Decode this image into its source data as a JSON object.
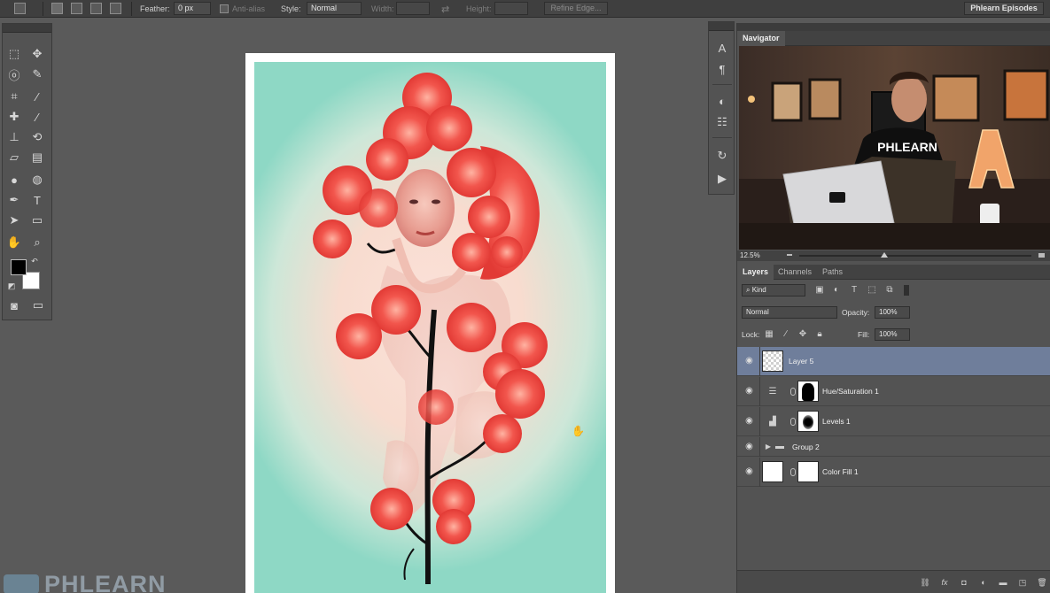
{
  "options_bar": {
    "feather_label": "Feather:",
    "feather_value": "0 px",
    "anti_alias_label": "Anti-alias",
    "style_label": "Style:",
    "style_value": "Normal",
    "width_label": "Width:",
    "height_label": "Height:",
    "refine_edge_label": "Refine Edge...",
    "workspace_label": "Phlearn Episodes"
  },
  "tools": [
    {
      "name": "marquee-tool-icon",
      "glyph": "⬚"
    },
    {
      "name": "move-tool-icon",
      "glyph": "✥"
    },
    {
      "name": "lasso-tool-icon",
      "glyph": "ⓞ"
    },
    {
      "name": "quick-selection-tool-icon",
      "glyph": "✎"
    },
    {
      "name": "crop-tool-icon",
      "glyph": "⌗"
    },
    {
      "name": "eyedropper-tool-icon",
      "glyph": "⁄"
    },
    {
      "name": "healing-brush-tool-icon",
      "glyph": "✚"
    },
    {
      "name": "brush-tool-icon",
      "glyph": "∕"
    },
    {
      "name": "clone-stamp-tool-icon",
      "glyph": "⊥"
    },
    {
      "name": "history-brush-tool-icon",
      "glyph": "⟲"
    },
    {
      "name": "eraser-tool-icon",
      "glyph": "▱"
    },
    {
      "name": "gradient-tool-icon",
      "glyph": "▤"
    },
    {
      "name": "blur-tool-icon",
      "glyph": "●"
    },
    {
      "name": "dodge-tool-icon",
      "glyph": "◍"
    },
    {
      "name": "pen-tool-icon",
      "glyph": "✒"
    },
    {
      "name": "type-tool-icon",
      "glyph": "T"
    },
    {
      "name": "path-selection-tool-icon",
      "glyph": "➤"
    },
    {
      "name": "shape-tool-icon",
      "glyph": "▭"
    },
    {
      "name": "hand-tool-icon",
      "glyph": "✋"
    },
    {
      "name": "zoom-tool-icon",
      "glyph": "⌕"
    }
  ],
  "strip_icons": [
    "character-icon",
    "paragraph-icon",
    "adjustments-icon",
    "properties-icon",
    "history-icon",
    "actions-icon"
  ],
  "navigator": {
    "tab_label": "Navigator",
    "zoom_value": "12.5%",
    "tshirt_text": "PHLEARN",
    "sign_letter": "A"
  },
  "layers_panel": {
    "tabs": [
      "Layers",
      "Channels",
      "Paths"
    ],
    "kind_label": "Kind",
    "blend_mode": "Normal",
    "opacity_label": "Opacity:",
    "opacity_value": "100%",
    "lock_label": "Lock:",
    "fill_label": "Fill:",
    "fill_value": "100%",
    "layers": [
      {
        "name": "Layer 5",
        "selected": true
      },
      {
        "name": "Hue/Saturation 1",
        "selected": false
      },
      {
        "name": "Levels 1",
        "selected": false
      },
      {
        "name": "Group 2",
        "selected": false
      },
      {
        "name": "Color Fill 1",
        "selected": false
      }
    ],
    "footer_icons": [
      "link-layers-icon",
      "fx-icon",
      "add-mask-icon",
      "adjustment-layer-icon",
      "new-group-icon",
      "new-layer-icon",
      "delete-layer-icon"
    ]
  },
  "watermark": {
    "text": "PHLEARN"
  },
  "colors": {
    "selected_layer": "#6f7e9b",
    "flower_red": "#ef4a44",
    "background_mint": "#8ed8c5"
  }
}
